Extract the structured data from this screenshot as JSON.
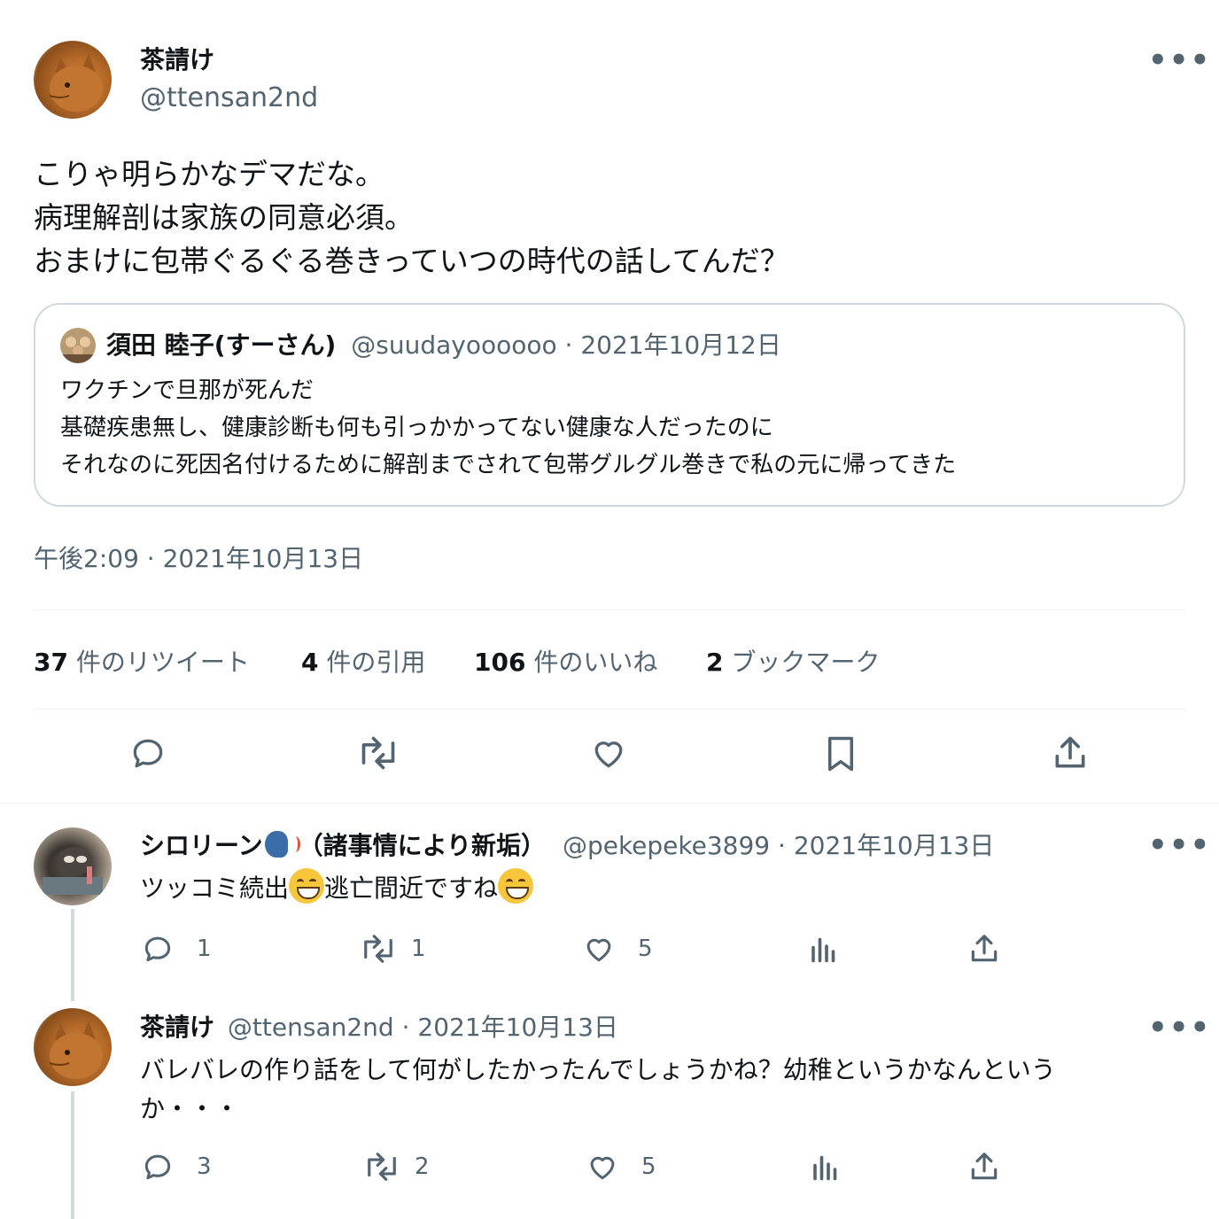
{
  "main_tweet": {
    "display_name": "茶請け",
    "handle": "@ttensan2nd",
    "lines": [
      "こりゃ明らかなデマだな。",
      "病理解剖は家族の同意必須。",
      "おまけに包帯ぐるぐる巻きっていつの時代の話してんだ？"
    ],
    "timestamp": "午後2:09 · 2021年10月13日"
  },
  "quoted_tweet": {
    "display_name": "須田 睦子(すーさん)",
    "handle_date": "@suudayoooooo · 2021年10月12日",
    "lines": [
      "ワクチンで旦那が死んだ",
      "基礎疾患無し、健康診断も何も引っかかってない健康な人だったのに",
      "それなのに死因名付けるために解剖までされて包帯グルグル巻きで私の元に帰ってきた"
    ]
  },
  "stats": {
    "retweets_count": "37",
    "retweets_label": "件のリツイート",
    "quotes_count": "4",
    "quotes_label": "件の引用",
    "likes_count": "106",
    "likes_label": "件のいいね",
    "bookmarks_count": "2",
    "bookmarks_label": "ブックマーク"
  },
  "replies": [
    {
      "display_name": "シロリーン",
      "name_suffix": "（諸事情により新垢）",
      "handle_date": "@pekepeke3899 · 2021年10月13日",
      "text_part1": "ツッコミ続出",
      "text_part2": "逃亡間近ですね",
      "reply_count": "1",
      "retweet_count": "1",
      "like_count": "5"
    },
    {
      "display_name": "茶請け",
      "handle_date": "@ttensan2nd · 2021年10月13日",
      "text_line1": "バレバレの作り話をして何がしたかったんでしょうかね？幼稚というかなんという",
      "text_line2": "か・・・",
      "reply_count": "3",
      "retweet_count": "2",
      "like_count": "5"
    }
  ],
  "more_glyph": "•••",
  "colors": {
    "text": "#0f1419",
    "muted": "#536471",
    "border": "#cfd9de",
    "divider": "#eff3f4"
  }
}
